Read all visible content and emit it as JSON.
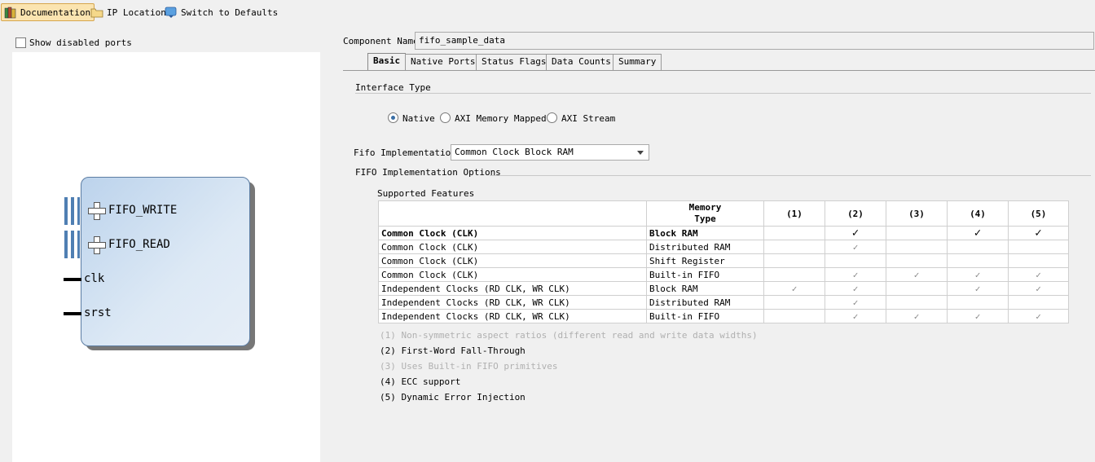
{
  "toolbar": {
    "documentation": "Documentation",
    "ip_location": "IP Location",
    "switch_defaults": "Switch to Defaults"
  },
  "left": {
    "show_disabled": "Show disabled ports",
    "ports": {
      "fifo_write": "FIFO_WRITE",
      "fifo_read": "FIFO_READ",
      "clk": "clk",
      "srst": "srst"
    }
  },
  "component": {
    "label": "Component Name",
    "value": "fifo_sample_data"
  },
  "tabs": [
    "Basic",
    "Native Ports",
    "Status Flags",
    "Data Counts",
    "Summary"
  ],
  "interface": {
    "title": "Interface Type",
    "options": [
      "Native",
      "AXI Memory Mapped",
      "AXI Stream"
    ],
    "selected": "Native"
  },
  "fifo_impl": {
    "label": "Fifo Implementation",
    "value": "Common Clock Block RAM"
  },
  "options_title": "FIFO Implementation Options",
  "supported_title": "Supported Features",
  "table": {
    "header_memory": "Memory",
    "header_type": "Type",
    "cols": [
      "(1)",
      "(2)",
      "(3)",
      "(4)",
      "(5)"
    ],
    "rows": [
      {
        "clock": "Common Clock (CLK)",
        "mem": "Block RAM",
        "checks": [
          "",
          "✓",
          "",
          "✓",
          "✓"
        ]
      },
      {
        "clock": "Common Clock (CLK)",
        "mem": "Distributed RAM",
        "checks": [
          "",
          "✓",
          "",
          "",
          ""
        ]
      },
      {
        "clock": "Common Clock (CLK)",
        "mem": "Shift Register",
        "checks": [
          "",
          "",
          "",
          "",
          ""
        ]
      },
      {
        "clock": "Common Clock (CLK)",
        "mem": "Built-in FIFO",
        "checks": [
          "",
          "✓",
          "✓",
          "✓",
          "✓"
        ]
      },
      {
        "clock": "Independent Clocks (RD CLK, WR CLK)",
        "mem": "Block RAM",
        "checks": [
          "✓",
          "✓",
          "",
          "✓",
          "✓"
        ]
      },
      {
        "clock": "Independent Clocks (RD CLK, WR CLK)",
        "mem": "Distributed RAM",
        "checks": [
          "",
          "✓",
          "",
          "",
          ""
        ]
      },
      {
        "clock": "Independent Clocks (RD CLK, WR CLK)",
        "mem": "Built-in FIFO",
        "checks": [
          "",
          "✓",
          "✓",
          "✓",
          "✓"
        ]
      }
    ]
  },
  "notes": [
    {
      "text": "(1) Non-symmetric aspect ratios (different read and write data widths)",
      "dim": true
    },
    {
      "text": "(2) First-Word Fall-Through",
      "dim": false
    },
    {
      "text": "(3) Uses Built-in FIFO primitives",
      "dim": true
    },
    {
      "text": "(4) ECC support",
      "dim": false
    },
    {
      "text": "(5) Dynamic Error Injection",
      "dim": false
    }
  ]
}
